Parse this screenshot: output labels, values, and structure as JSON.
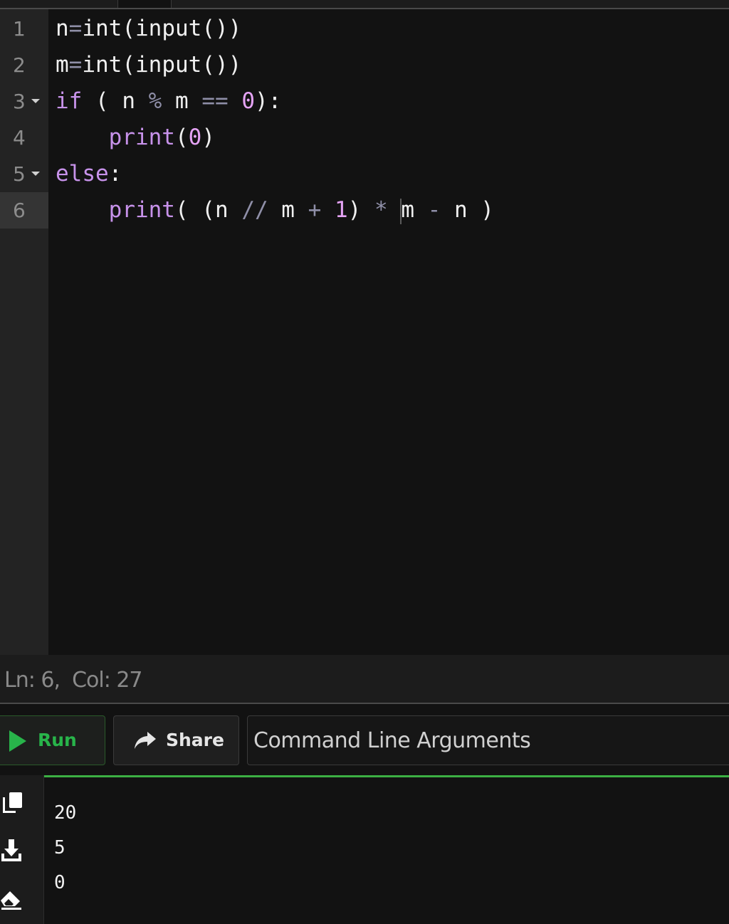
{
  "editor": {
    "line_numbers": [
      "1",
      "2",
      "3",
      "4",
      "5",
      "6"
    ],
    "lines": {
      "l1": {
        "var": "n",
        "eq": "=",
        "call": "int(input())"
      },
      "l2": {
        "var": "m",
        "eq": "=",
        "call": "int(input())"
      },
      "l3": {
        "kw": "if",
        "p1": " ( ",
        "a": "n",
        "mod": " % ",
        "b": "m",
        "cmp": " == ",
        "zero": "0",
        "end": "):"
      },
      "l4": {
        "indent": "    ",
        "fn": "print",
        "open": "(",
        "zero": "0",
        "close": ")"
      },
      "l5": {
        "kw": "else",
        "colon": ":"
      },
      "l6": {
        "indent": "    ",
        "fn": "print",
        "open": "( (n ",
        "floordiv": "//",
        "m1": " m ",
        "plus": "+",
        "one": " 1",
        "close1": ") ",
        "star": "*",
        "sp": " ",
        "m2": "m ",
        "minus": "-",
        "n2": " n )"
      }
    }
  },
  "status": {
    "text": "Ln: 6,  Col: 27"
  },
  "toolbar": {
    "run_label": "Run",
    "share_label": "Share",
    "cli_placeholder": "Command Line Arguments"
  },
  "output": {
    "lines": [
      "20",
      "5",
      "0"
    ]
  },
  "icons": {
    "fold": "chevron-down-icon",
    "run": "play-icon",
    "share": "share-arrow-icon",
    "copy": "copy-icon",
    "download": "download-icon",
    "clear": "eraser-icon"
  },
  "colors": {
    "keyword": "#c792ea",
    "run_green": "#28b44a",
    "terminal_border": "#3cb043"
  }
}
